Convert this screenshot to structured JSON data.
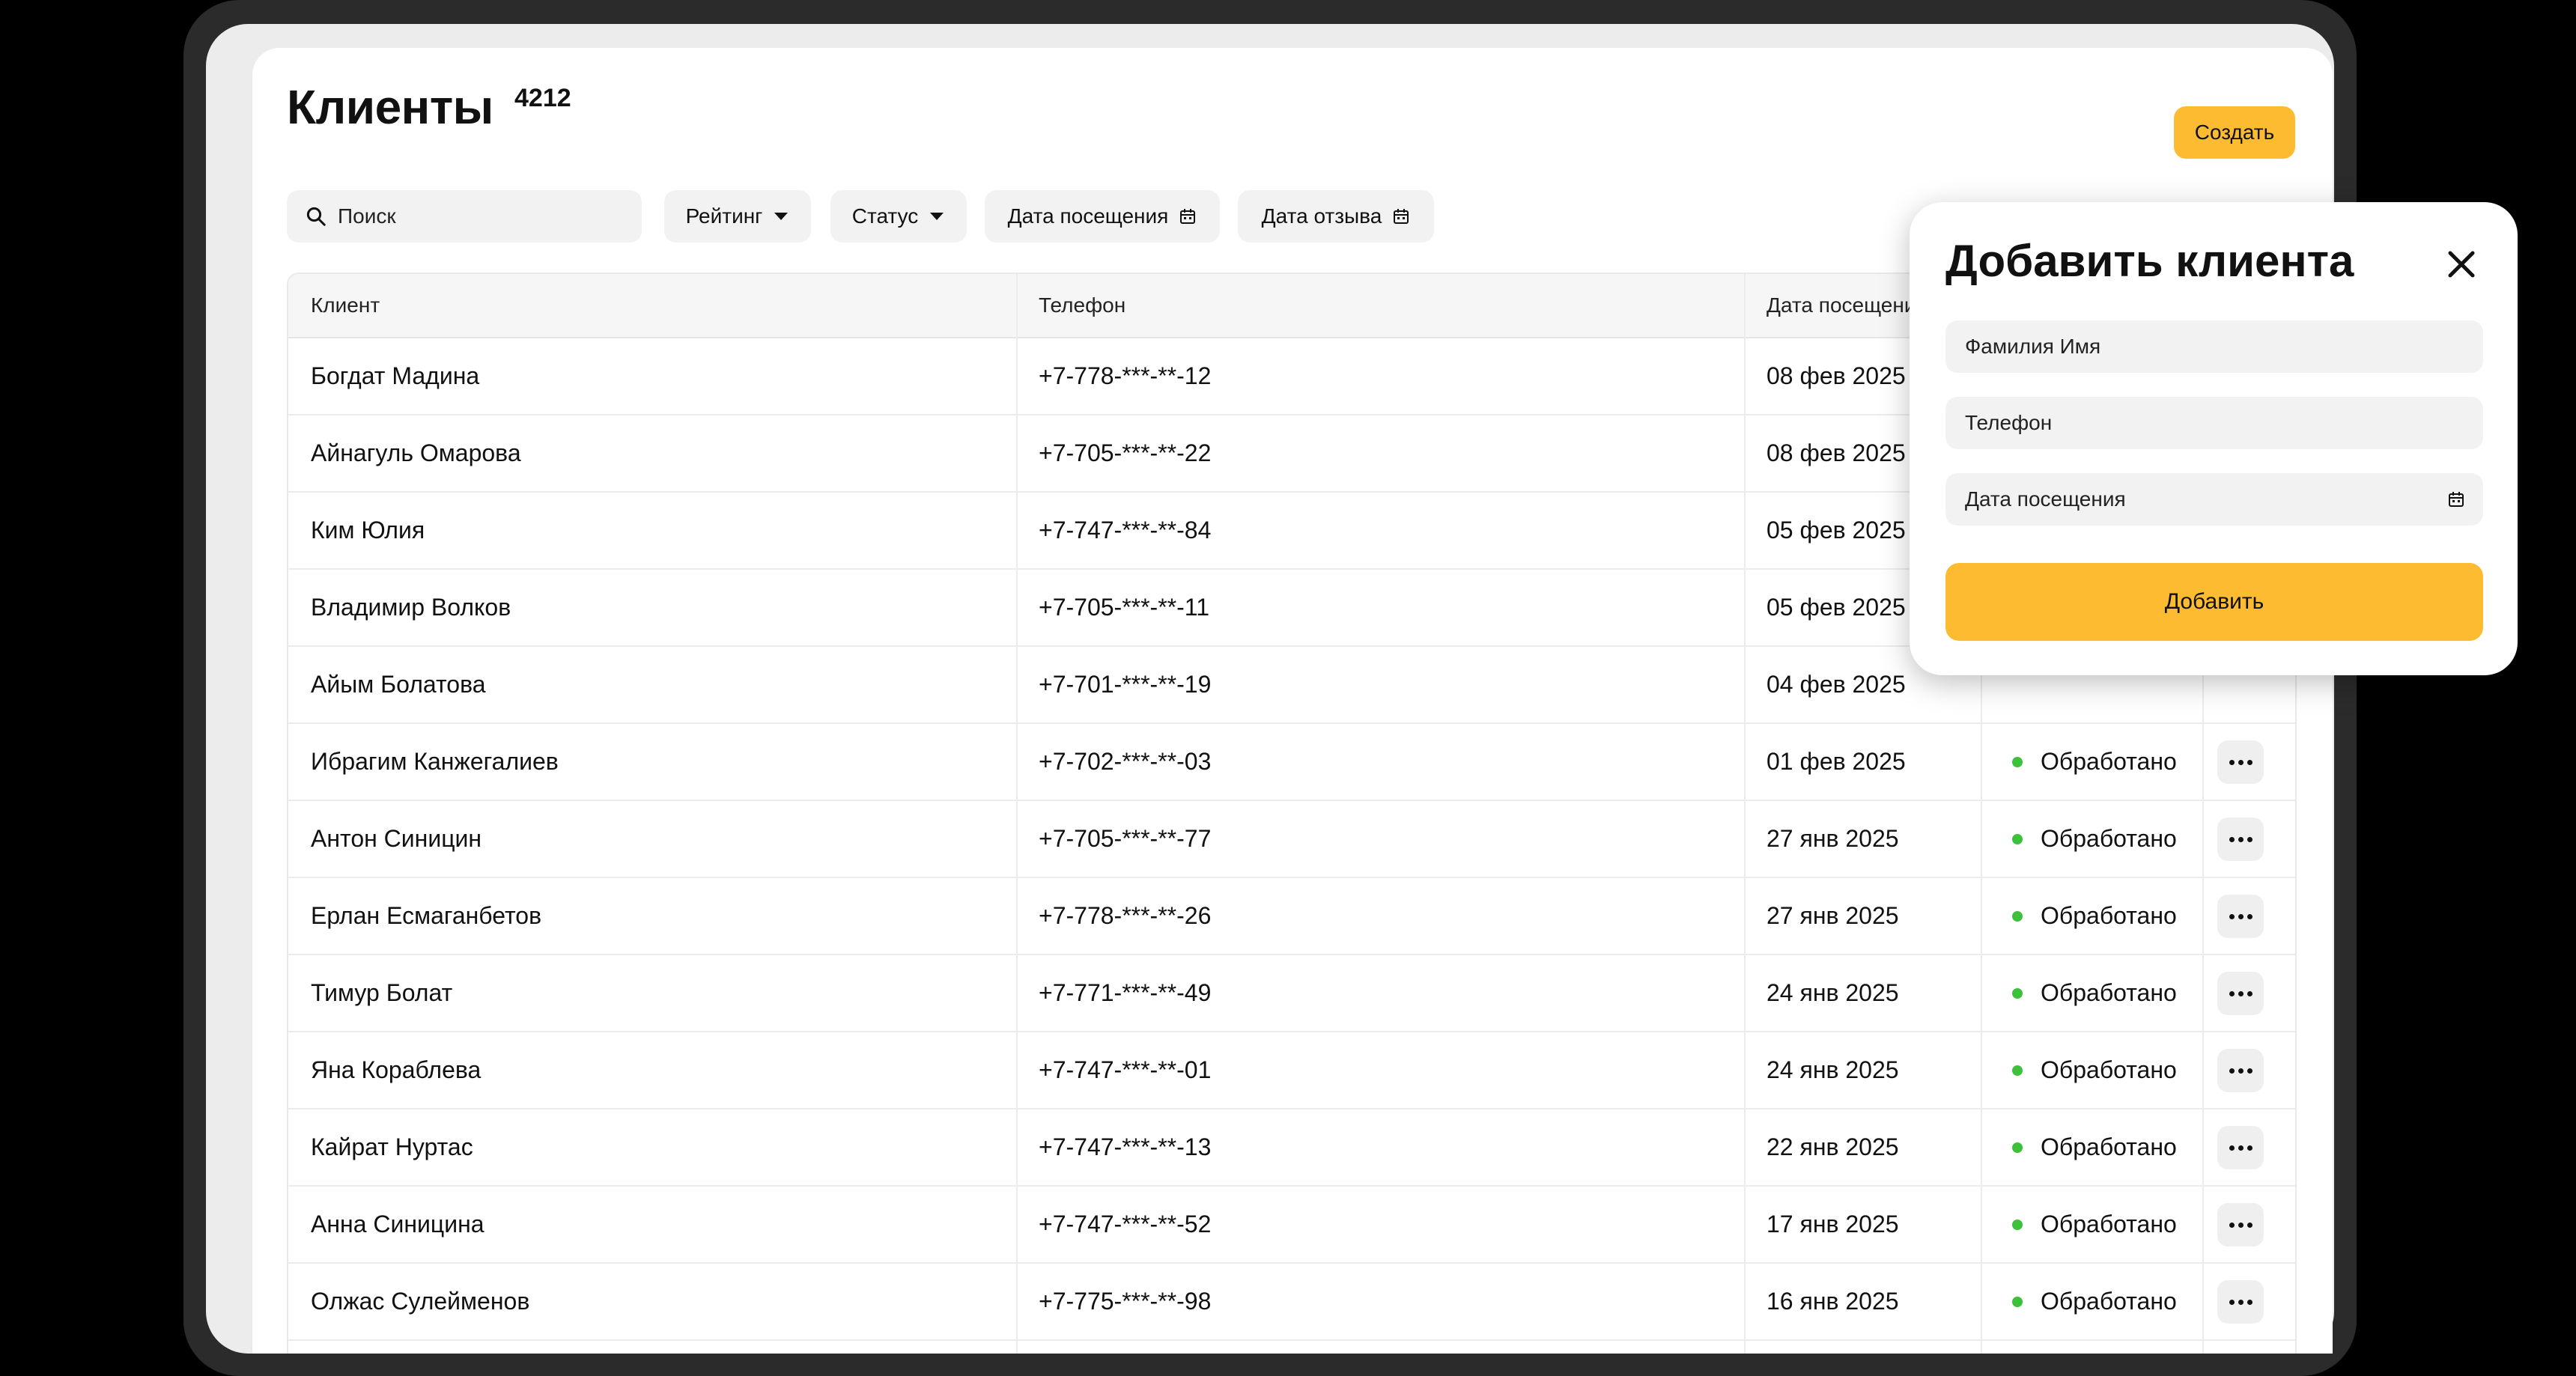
{
  "header": {
    "title": "Клиенты",
    "count": "4212",
    "create_label": "Создать"
  },
  "filters": {
    "search_placeholder": "Поиск",
    "rating_label": "Рейтинг",
    "status_label": "Статус",
    "visit_date_label": "Дата посещения",
    "review_date_label": "Дата отзыва"
  },
  "table": {
    "columns": [
      "Клиент",
      "Телефон",
      "Дата посещения"
    ],
    "rows": [
      {
        "name": "Богдат Мадина",
        "phone": "+7-778-***-**-12",
        "date": "08 фев 2025",
        "status": ""
      },
      {
        "name": "Айнагуль Омарова",
        "phone": "+7-705-***-**-22",
        "date": "08 фев 2025",
        "status": ""
      },
      {
        "name": "Ким Юлия",
        "phone": "+7-747-***-**-84",
        "date": "05 фев 2025",
        "status": ""
      },
      {
        "name": "Владимир Волков",
        "phone": "+7-705-***-**-11",
        "date": "05 фев 2025",
        "status": ""
      },
      {
        "name": "Айым Болатова",
        "phone": "+7-701-***-**-19",
        "date": "04 фев 2025",
        "status": ""
      },
      {
        "name": "Ибрагим Канжегалиев",
        "phone": "+7-702-***-**-03",
        "date": "01 фев 2025",
        "status": "Обработано"
      },
      {
        "name": "Антон Синицин",
        "phone": "+7-705-***-**-77",
        "date": "27 янв 2025",
        "status": "Обработано"
      },
      {
        "name": "Ерлан Есмаганбетов",
        "phone": "+7-778-***-**-26",
        "date": "27 янв 2025",
        "status": "Обработано"
      },
      {
        "name": "Тимур Болат",
        "phone": "+7-771-***-**-49",
        "date": "24 янв 2025",
        "status": "Обработано"
      },
      {
        "name": "Яна Кораблева",
        "phone": "+7-747-***-**-01",
        "date": "24 янв 2025",
        "status": "Обработано"
      },
      {
        "name": "Кайрат Нуртас",
        "phone": "+7-747-***-**-13",
        "date": "22 янв 2025",
        "status": "Обработано"
      },
      {
        "name": "Анна Синицина",
        "phone": "+7-747-***-**-52",
        "date": "17 янв 2025",
        "status": "Обработано"
      },
      {
        "name": "Олжас Сулейменов",
        "phone": "+7-775-***-**-98",
        "date": "16 янв 2025",
        "status": "Обработано"
      }
    ]
  },
  "popup": {
    "title": "Добавить клиента",
    "name_placeholder": "Фамилия Имя",
    "phone_placeholder": "Телефон",
    "date_placeholder": "Дата посещения",
    "submit_label": "Добавить"
  },
  "colors": {
    "accent": "#fcbb30",
    "status_ok": "#3cc13b"
  },
  "icons": {
    "search": "search-icon",
    "dropdown": "caret-down-icon",
    "calendar": "calendar-icon",
    "close": "close-icon",
    "more": "more-dots-icon"
  }
}
